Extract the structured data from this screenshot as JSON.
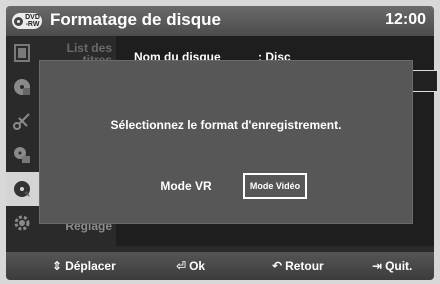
{
  "header": {
    "badge_top": "DVD",
    "badge_bottom": "-RW",
    "title": "Formatage de disque",
    "clock": "12:00"
  },
  "sidebar": {
    "items": [
      {
        "icon": "film-icon",
        "label": "List des titres",
        "active": false
      },
      {
        "icon": "disc-manager-icon",
        "label": "",
        "active": false
      },
      {
        "icon": "scissors-icon",
        "label": "",
        "active": false
      },
      {
        "icon": "copy-icon",
        "label": "",
        "active": false
      },
      {
        "icon": "disc-icon",
        "label": "",
        "active": true
      },
      {
        "icon": "gear-icon",
        "label": "Réglage",
        "active": false
      }
    ]
  },
  "main": {
    "disc_name_label": "Nom du disque",
    "disc_name_value": ": Disc"
  },
  "dialog": {
    "message": "Sélectionnez le format d'enregistrement.",
    "button_vr": "Mode VR",
    "button_video": "Mode Vidéo"
  },
  "footer": {
    "move_icon": "⇕",
    "move": "Déplacer",
    "ok_icon": "⏎",
    "ok": "Ok",
    "back_icon": "↶",
    "back": "Retour",
    "quit_icon": "⇥",
    "quit": "Quit."
  }
}
